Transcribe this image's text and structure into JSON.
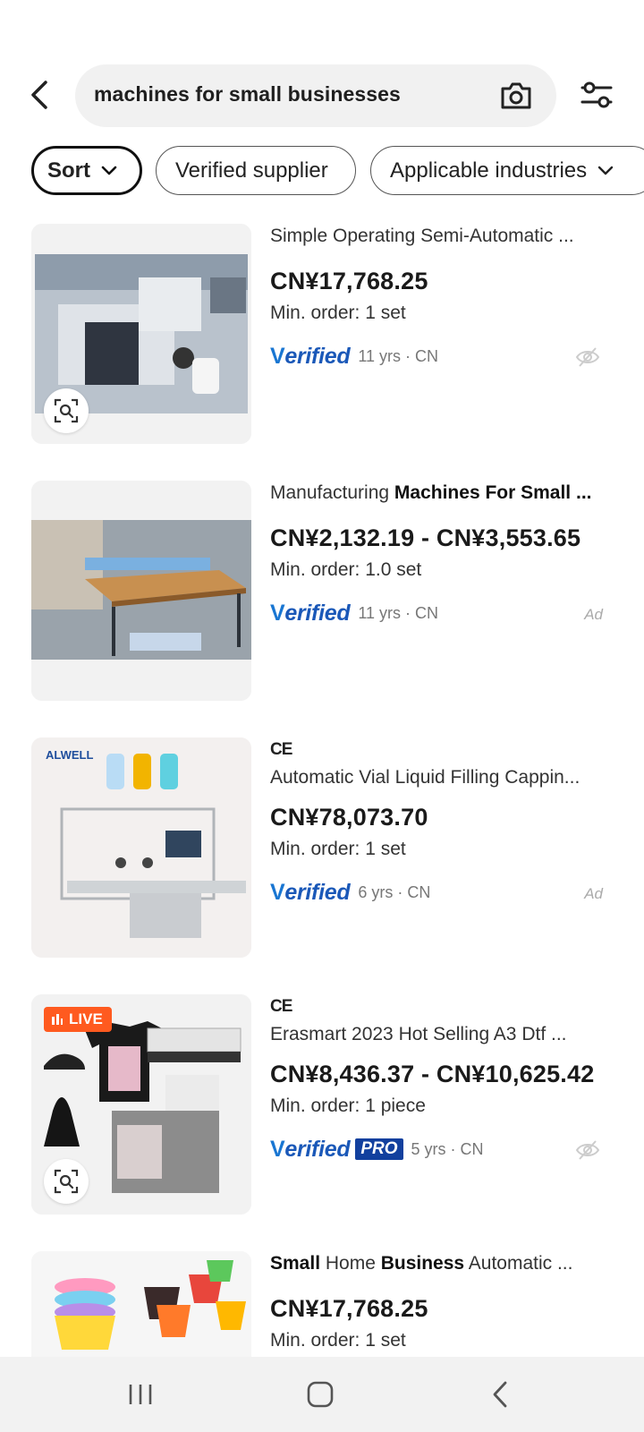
{
  "search": {
    "query": "machines for small businesses"
  },
  "chips": [
    {
      "label": "Sort"
    },
    {
      "label": "Verified supplier"
    },
    {
      "label": "Applicable industries"
    }
  ],
  "products": [
    {
      "title_plain": "Simple Operating  Semi-Automatic ...",
      "price": "CN¥17,768.25",
      "moq": "Min. order: 1 set",
      "verified_label": "erified",
      "years": "11 yrs · CN",
      "right_marker": "hide-icon"
    },
    {
      "title_prefix": "Manufacturing ",
      "title_bold": "Machines For Small ...",
      "price": "CN¥2,132.19 - CN¥3,553.65",
      "moq": "Min. order: 1.0 set",
      "verified_label": "erified",
      "years": "11 yrs · CN",
      "ad": "Ad"
    },
    {
      "ce": "CE",
      "title_plain": "Automatic Vial Liquid Filling Cappin...",
      "price": "CN¥78,073.70",
      "moq": "Min. order: 1 set",
      "verified_label": "erified",
      "years": "6 yrs · CN",
      "ad": "Ad",
      "brand": "ALWELL"
    },
    {
      "ce": "CE",
      "title_plain": "Erasmart 2023 Hot Selling A3 Dtf ...",
      "price": "CN¥8,436.37 - CN¥10,625.42",
      "moq": "Min. order: 1 piece",
      "verified_label": "erified",
      "pro": "PRO",
      "years": "5 yrs · CN",
      "live": "LIVE",
      "right_marker": "hide-icon"
    },
    {
      "title_b1": "Small",
      "title_m1": " Home ",
      "title_b2": "Business",
      "title_m2": " Automatic ...",
      "price": "CN¥17,768.25",
      "moq": "Min. order: 1 set"
    }
  ],
  "verified_v": "V",
  "colors": {
    "verified_blue": "#1a58b8",
    "live_orange": "#ff5a1f",
    "pro_navy": "#12409e"
  }
}
